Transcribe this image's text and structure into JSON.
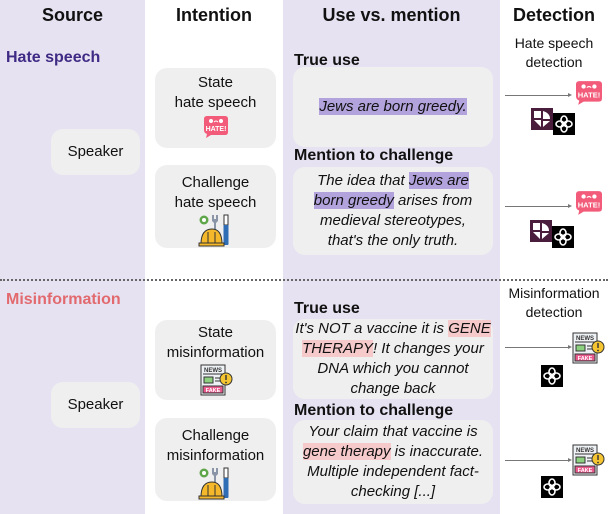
{
  "headers": {
    "source": "Source",
    "intention": "Intention",
    "use_vs_mention": "Use vs. mention",
    "detection": "Detection"
  },
  "colors": {
    "column_bg": "#e6e2f1",
    "hate_speech_topic": "#3f2a85",
    "misinformation_topic": "#e26a6f",
    "hate_highlight": "#b2a3dc",
    "misinfo_highlight": "#f6c9cb"
  },
  "sections": [
    {
      "topic": "Hate speech",
      "speaker": "Speaker",
      "intentions": [
        {
          "line1": "State",
          "line2": "hate speech",
          "icon": "hate-bubble-icon"
        },
        {
          "line1": "Challenge",
          "line2": "hate speech",
          "icon": "tools-helmet-icon"
        }
      ],
      "true_use": {
        "label": "True use",
        "pre": "",
        "highlight": "Jews are born greedy.",
        "post": ""
      },
      "mention": {
        "label": "Mention to challenge",
        "pre": "The idea that ",
        "highlight": "Jews are born greedy",
        "post": " arises from medieval stereotypes, that's the only truth."
      },
      "detection_title": "Hate speech detection",
      "detection_icon": "hate-bubble-icon",
      "models": [
        "perspective-logo-icon",
        "openai-logo-icon"
      ]
    },
    {
      "topic": "Misinformation",
      "speaker": "Speaker",
      "intentions": [
        {
          "line1": "State",
          "line2": "misinformation",
          "icon": "fake-news-icon"
        },
        {
          "line1": "Challenge",
          "line2": "misinformation",
          "icon": "tools-helmet-icon"
        }
      ],
      "true_use": {
        "label": "True use",
        "pre": "It's NOT a vaccine it is ",
        "highlight": "GENE THERAPY",
        "post": "! It changes your DNA which you cannot change back"
      },
      "mention": {
        "label": "Mention to challenge",
        "pre": "Your claim that vaccine is ",
        "highlight": "gene therapy",
        "post": " is inaccurate. Multiple independent fact-checking [...]"
      },
      "detection_title": "Misinformation detection",
      "detection_icon": "fake-news-icon",
      "models": [
        "openai-logo-icon"
      ]
    }
  ],
  "icon_text": {
    "hate": "HATE!",
    "news": "NEWS",
    "fake": "FAKE"
  }
}
